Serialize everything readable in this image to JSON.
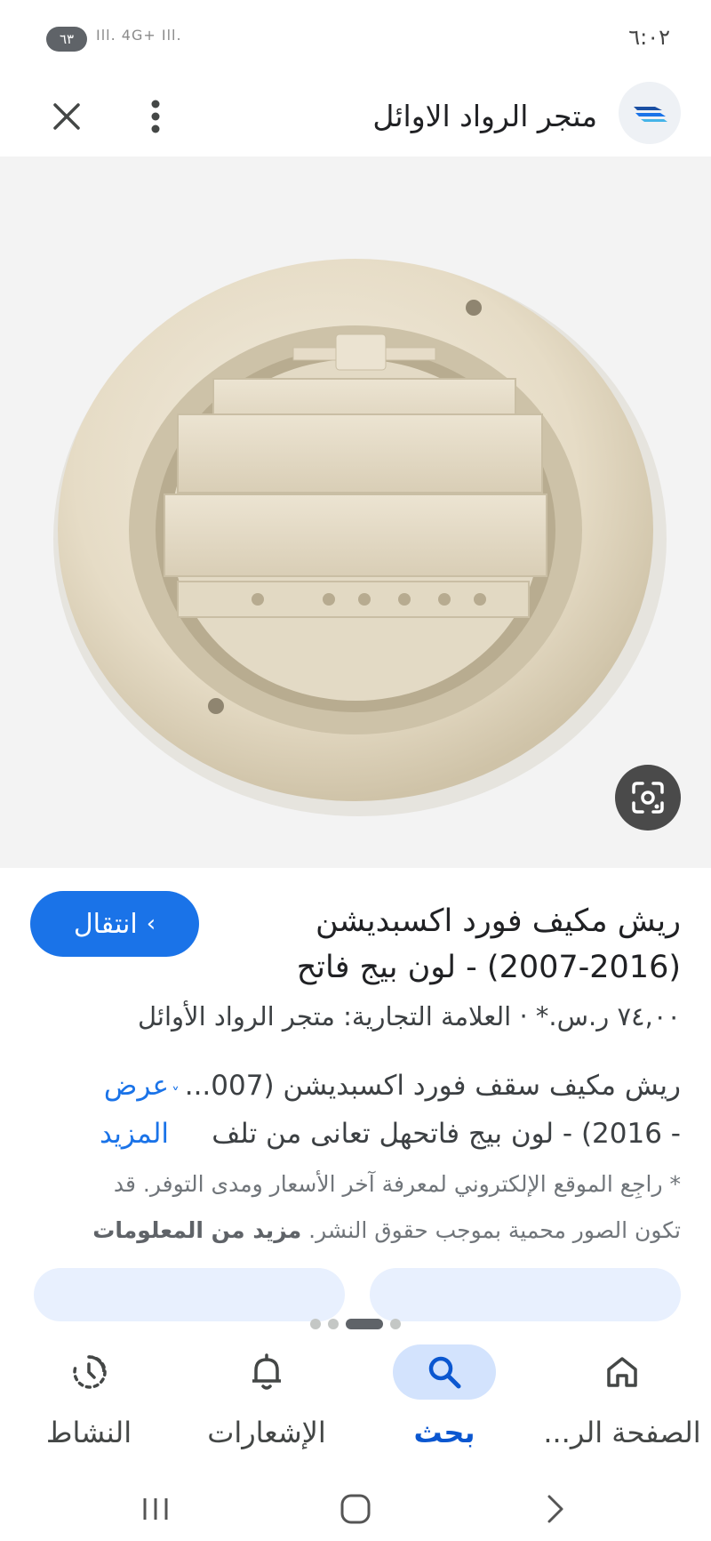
{
  "status": {
    "battery": "٦٣",
    "signal": "Ill. 4G+ Ill.",
    "time": "٦:٠٢"
  },
  "app_bar": {
    "site_name": "متجر الرواد الاوائل"
  },
  "colors": {
    "accent": "#1a73e8",
    "nav_active_bg": "#d3e3fd",
    "product_beige": "#ece4d3"
  },
  "result": {
    "visit_label": "انتقال",
    "title_line1": "ريش مكيف فورد اكسبديشن",
    "title_line2": "(2007-2016) - لون بيج فاتح",
    "meta": "٧٤,٠٠ ر.س.* · العلامة التجارية: متجر الرواد الأوائل",
    "desc_line1": "ريش مكيف سقف فورد اكسبديشن (007...",
    "desc_line2": "- 2016) - لون بيج فاتحهل تعانى من تلف",
    "show_more_line1": "عرض",
    "show_more_line2": "المزيد",
    "disclaimer_line1": "* راجِع الموقع الإلكتروني لمعرفة آخر الأسعار ومدى التوفر. قد",
    "disclaimer_line2": "تكون الصور محمية بموجب حقوق النشر.",
    "disclaimer_more": "مزيد من المعلومات"
  },
  "pager": {
    "count": 4,
    "active": 2
  },
  "bottom_nav": [
    {
      "label": "النشاط",
      "icon": "activity-icon"
    },
    {
      "label": "الإشعارات",
      "icon": "bell-icon"
    },
    {
      "label": "بحث",
      "icon": "search-icon"
    },
    {
      "label": "الصفحة الر...",
      "icon": "home-icon"
    }
  ]
}
